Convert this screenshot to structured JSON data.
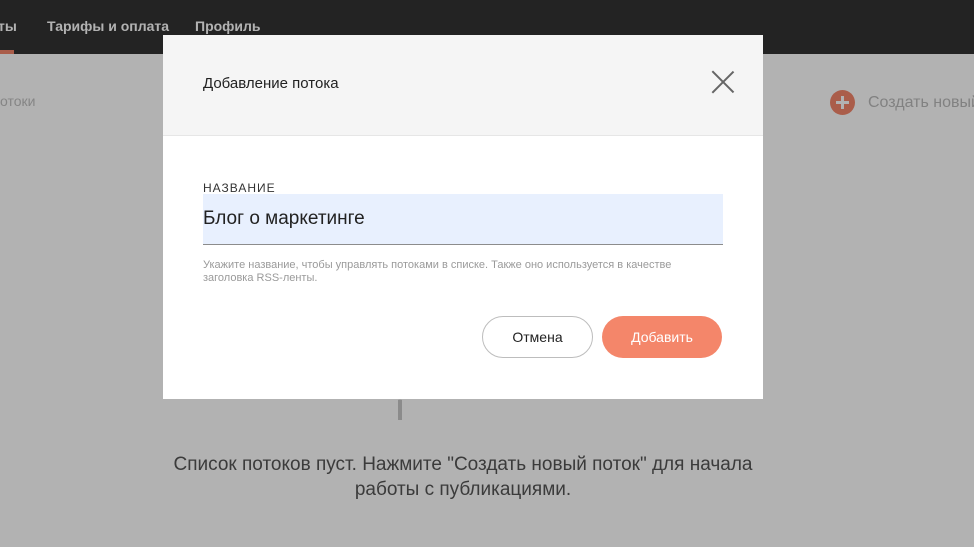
{
  "topnav": {
    "items": [
      "ты",
      "Тарифы и оплата",
      "Профиль"
    ]
  },
  "subheader": {
    "left_text": "отоки",
    "create_label": "Создать новый"
  },
  "empty_state": {
    "message": "Список потоков пуст. Нажмите \"Создать новый поток\" для начала работы с публикациями."
  },
  "modal": {
    "title": "Добавление потока",
    "field": {
      "label": "НАЗВАНИЕ",
      "value": "Блог о маркетинге",
      "hint": "Укажите название, чтобы управлять потоками в списке. Также оно используется в качестве заголовка RSS-ленты."
    },
    "buttons": {
      "cancel": "Отмена",
      "add": "Добавить"
    }
  },
  "colors": {
    "accent": "#f4866a",
    "nav_background": "#333333",
    "input_background": "#e8f0fe"
  },
  "icons": {
    "close": "close-icon",
    "create": "plus-circle-icon"
  }
}
